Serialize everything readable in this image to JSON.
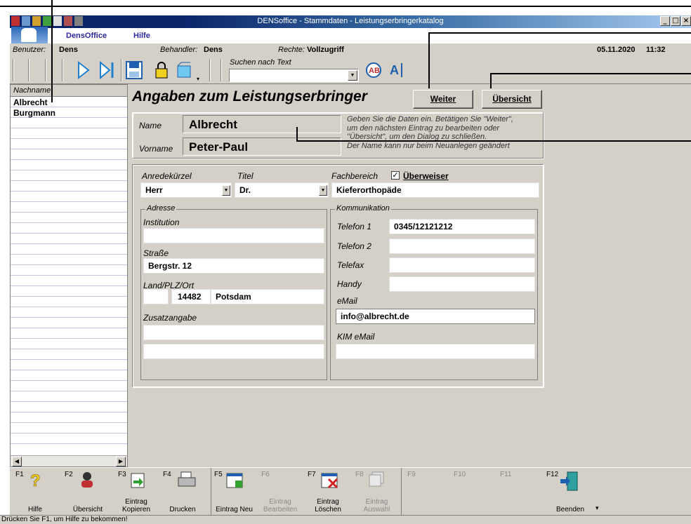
{
  "window": {
    "title": "DENSoffice - Stammdaten - Leistungserbringerkatalog"
  },
  "menu": {
    "items": [
      "DensOffice",
      "Hilfe"
    ]
  },
  "infobar": {
    "user_label": "Benutzer:",
    "user": "Dens",
    "treater_label": "Behandler:",
    "treater": "Dens",
    "rights_label": "Rechte:",
    "rights": "Vollzugriff",
    "date": "05.11.2020",
    "time": "11:32"
  },
  "toolbar": {
    "search_label": "Suchen nach Text",
    "search_value": ""
  },
  "list": {
    "header": "Nachname",
    "rows": [
      "Albrecht",
      "Burgmann"
    ]
  },
  "form": {
    "heading": "Angaben zum Leistungserbringer",
    "next_button": "Weiter",
    "overview_button": "Übersicht",
    "name_label": "Name",
    "name_value": "Albrecht",
    "firstname_label": "Vorname",
    "firstname_value": "Peter-Paul",
    "help_text_1": "Geben Sie die Daten ein. Betätigen Sie \"Weiter\",",
    "help_text_2": "um den nächsten Eintrag zu bearbeiten oder",
    "help_text_3": "\"Übersicht\", um den Dialog zu schließen.",
    "help_text_4": "Der Name kann nur beim Neuanlegen geändert",
    "salutation_label": "Anredekürzel",
    "salutation_value": "Herr",
    "title_label": "Titel",
    "title_value": "Dr.",
    "specialty_label": "Fachbereich",
    "referrer_label": "Überweiser",
    "referrer_checked": true,
    "specialty_value": "Kieferorthopäde",
    "address_legend": "Adresse",
    "institution_label": "Institution",
    "institution_value": "",
    "street_label": "Straße",
    "street_value": "Bergstr. 12",
    "city_label": "Land/PLZ/Ort",
    "country_value": "",
    "zip_value": "14482",
    "city_value": "Potsdam",
    "extra_label": "Zusatzangabe",
    "extra_value_1": "",
    "extra_value_2": "",
    "comm_legend": "Kommunikation",
    "phone1_label": "Telefon 1",
    "phone1_value": "0345/12121212",
    "phone2_label": "Telefon 2",
    "phone2_value": "",
    "fax_label": "Telefax",
    "fax_value": "",
    "mobile_label": "Handy",
    "mobile_value": "",
    "email_label": "eMail",
    "email_value": "info@albrecht.de",
    "kim_label": "KIM eMail",
    "kim_value": ""
  },
  "fkeys": [
    {
      "key": "F1",
      "label": "Hilfe",
      "enabled": true,
      "icon": "help-icon"
    },
    {
      "key": "F2",
      "label": "Übersicht",
      "enabled": true,
      "icon": "overview-icon"
    },
    {
      "key": "F3",
      "label": "Eintrag Kopieren",
      "enabled": true,
      "icon": "copy-entry-icon"
    },
    {
      "key": "F4",
      "label": "Drucken",
      "enabled": true,
      "icon": "printer-icon"
    },
    {
      "key": "F5",
      "label": "Eintrag Neu",
      "enabled": true,
      "icon": "new-entry-icon"
    },
    {
      "key": "F6",
      "label": "Eintrag Bearbeiten",
      "enabled": false,
      "icon": ""
    },
    {
      "key": "F7",
      "label": "Eintrag Löschen",
      "enabled": true,
      "icon": "delete-entry-icon"
    },
    {
      "key": "F8",
      "label": "Eintrag Auswahl",
      "enabled": false,
      "icon": "select-entry-icon"
    },
    {
      "key": "F9",
      "label": "",
      "enabled": false,
      "icon": ""
    },
    {
      "key": "F10",
      "label": "",
      "enabled": false,
      "icon": ""
    },
    {
      "key": "F11",
      "label": "",
      "enabled": false,
      "icon": ""
    },
    {
      "key": "F12",
      "label": "Beenden",
      "enabled": true,
      "icon": "exit-icon"
    }
  ],
  "status": {
    "text": "Drücken Sie F1, um Hilfe zu bekommen!"
  },
  "colors": {
    "titlebar": "#0a246a",
    "menu_text": "#2e2a9c",
    "face": "#d4d0c8",
    "list_lines": "#c4c4e6"
  }
}
